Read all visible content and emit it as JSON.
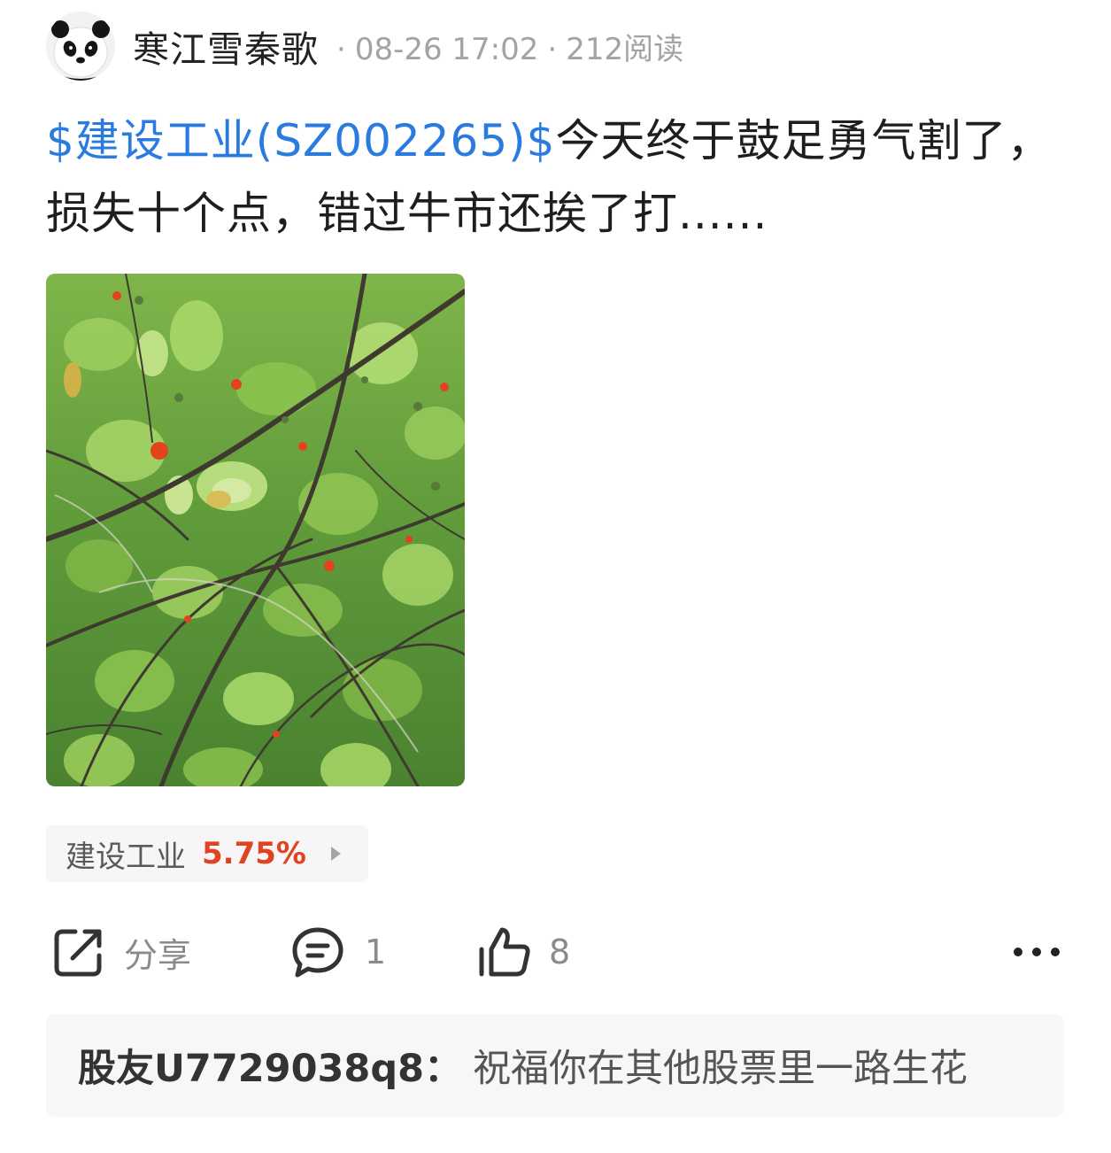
{
  "post": {
    "author": "寒江雪秦歌",
    "date": "08-26 17:02",
    "reads": "212阅读",
    "separator": "·",
    "stock_tag": "$建设工业(SZ002265)$",
    "body": "今天终于鼓足勇气割了，损失十个点，错过牛市还挨了打......",
    "image_alt": "树枝与绿叶间的红色果实"
  },
  "stock_chip": {
    "name": "建设工业",
    "change": "5.75%",
    "change_color": "#e0431f"
  },
  "actions": {
    "share_label": "分享",
    "comment_count": "1",
    "like_count": "8"
  },
  "comment_preview": {
    "user": "股友U7729038q8",
    "colon": "：",
    "text": "祝福你在其他股票里一路生花"
  },
  "colors": {
    "link": "#2a7be0",
    "meta": "#a3a3a3",
    "up": "#e0431f"
  },
  "icons": {
    "avatar": "panda-avatar",
    "share": "share-icon",
    "comment": "comment-icon",
    "like": "thumbs-up-icon",
    "more": "more-dots-icon",
    "chip_arrow": "triangle-right-icon"
  }
}
